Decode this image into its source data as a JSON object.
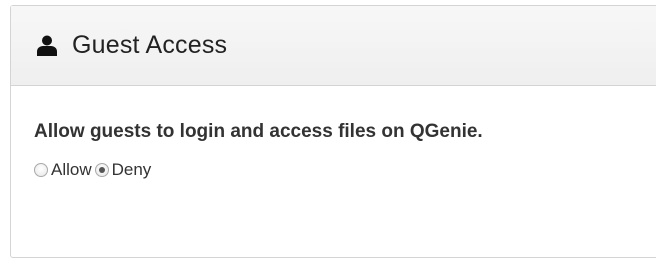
{
  "panel": {
    "title": "Guest Access",
    "icon": "user-icon",
    "description": "Allow guests to login and access files on QGenie."
  },
  "guest_access_options": {
    "selected": "Deny",
    "options": [
      {
        "label": "Allow",
        "checked": false
      },
      {
        "label": "Deny",
        "checked": true
      }
    ]
  }
}
